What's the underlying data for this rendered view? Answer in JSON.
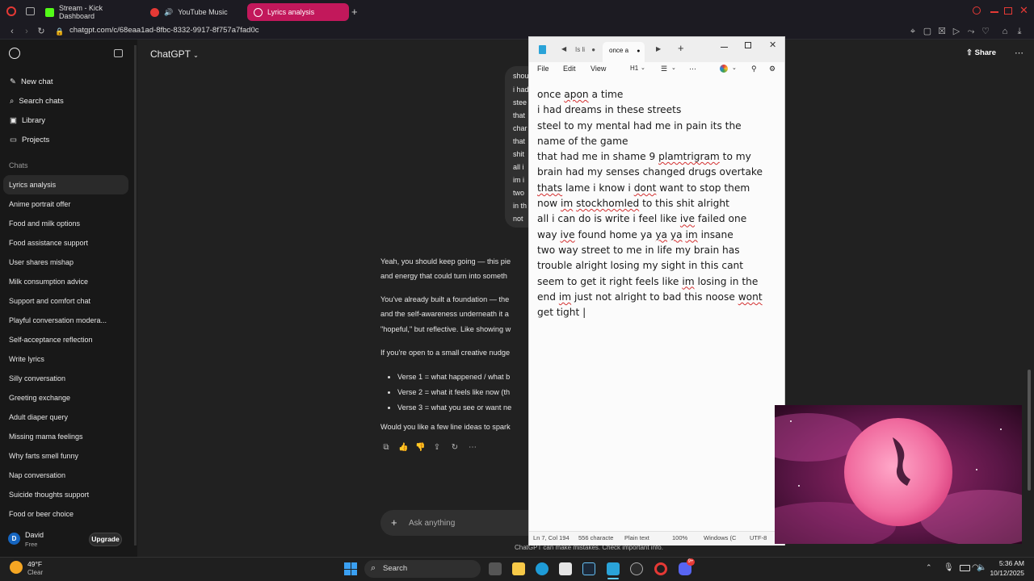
{
  "browser": {
    "tabs": [
      {
        "label": "Stream - Kick Dashboard",
        "active": false
      },
      {
        "label": "YouTube Music",
        "active": false
      },
      {
        "label": "Lyrics analysis",
        "active": true
      }
    ],
    "url": "chatgpt.com/c/68eaa1ad-8fbc-8332-9917-8f757a7fad0c"
  },
  "sidebar": {
    "nav": [
      {
        "label": "New chat",
        "icon": "edit-icon"
      },
      {
        "label": "Search chats",
        "icon": "search-icon"
      },
      {
        "label": "Library",
        "icon": "library-icon"
      },
      {
        "label": "Projects",
        "icon": "folder-icon"
      }
    ],
    "chats_heading": "Chats",
    "chats": [
      "Lyrics analysis",
      "Anime portrait offer",
      "Food and milk options",
      "Food assistance support",
      "User shares mishap",
      "Milk consumption advice",
      "Support and comfort chat",
      "Playful conversation modera...",
      "Self-acceptance reflection",
      "Write lyrics",
      "Silly conversation",
      "Greeting exchange",
      "Adult diaper query",
      "Missing mama feelings",
      "Why farts smell funny",
      "Nap conversation",
      "Suicide thoughts support",
      "Food or beer choice"
    ],
    "user": {
      "initial": "D",
      "name": "David",
      "plan": "Free",
      "upgrade_label": "Upgrade"
    }
  },
  "chat": {
    "title": "ChatGPT",
    "share_label": "Share",
    "user_message_fragments": [
      "shou",
      "i had",
      "stee",
      "that",
      "char",
      "that",
      "shit",
      "all i",
      "im i",
      "two",
      "in th",
      "not"
    ],
    "assistant": {
      "p1": [
        "Yeah, you should keep going — this pie",
        "and energy that could turn into someth"
      ],
      "p2": [
        "You've already built a foundation — the",
        "and the self-awareness underneath it a",
        "\"hopeful,\" but reflective. Like showing w"
      ],
      "p3": "If you're open to a small creative nudge",
      "bullets": [
        "Verse 1 = what happened / what b",
        "Verse 2 = what it feels like now (th",
        "Verse 3 = what you see or want ne"
      ],
      "p4": "Would you like a few line ideas to spark"
    },
    "ask_placeholder": "Ask anything",
    "disclaimer": "ChatGPT can make mistakes. Check important info."
  },
  "notepad": {
    "tabs": [
      "Is li",
      "once a"
    ],
    "menu": [
      "File",
      "Edit",
      "View",
      "H1"
    ],
    "lines": [
      [
        "once ",
        {
          "w": "apon"
        },
        " a time"
      ],
      [
        "i had dreams in these streets"
      ],
      [
        "steel to my mental had me in pain its the"
      ],
      [
        "name of the game"
      ],
      [
        "that had me in shame 9 ",
        {
          "w": "plamtrigram"
        },
        " to my"
      ],
      [
        "brain had my senses changed drugs overtake"
      ],
      [
        {
          "w": "thats"
        },
        " lame i know i ",
        {
          "w": "dont"
        },
        " want to stop them"
      ],
      [
        "now ",
        {
          "w": "im"
        },
        " ",
        {
          "w": "stockhomled"
        },
        " to this shit alright"
      ],
      [
        "all i can do is write i feel like ",
        {
          "w": "ive"
        },
        " failed one"
      ],
      [
        "way ",
        {
          "w": "ive"
        },
        " found home ya ",
        {
          "w": "ya"
        },
        " ",
        {
          "w": "ya"
        },
        " ",
        {
          "w": "im"
        },
        " insane"
      ],
      [
        "two way street to me in life my brain has"
      ],
      [
        "trouble alright losing my sight in this cant"
      ],
      [
        "seem to get it right feels like ",
        {
          "w": "im"
        },
        " losing in the"
      ],
      [
        "end ",
        {
          "w": "im"
        },
        " just not alright to bad this noose ",
        {
          "w": "wont"
        }
      ],
      [
        "get tight |"
      ]
    ],
    "status": {
      "position": "Ln 7, Col 194",
      "chars": "556 characte",
      "format": "Plain text",
      "zoom": "100%",
      "eol": "Windows (C",
      "encoding": "UTF-8"
    }
  },
  "taskbar": {
    "weather_temp": "49°F",
    "weather_desc": "Clear",
    "search_label": "Search",
    "time": "5:36 AM",
    "date": "10/12/2025",
    "discord_badge": "9+"
  },
  "colors": {
    "accent": "#c2185b",
    "notepad_bg": "#fbfbfb",
    "sidebar_bg": "#181818",
    "main_bg": "#212121"
  }
}
